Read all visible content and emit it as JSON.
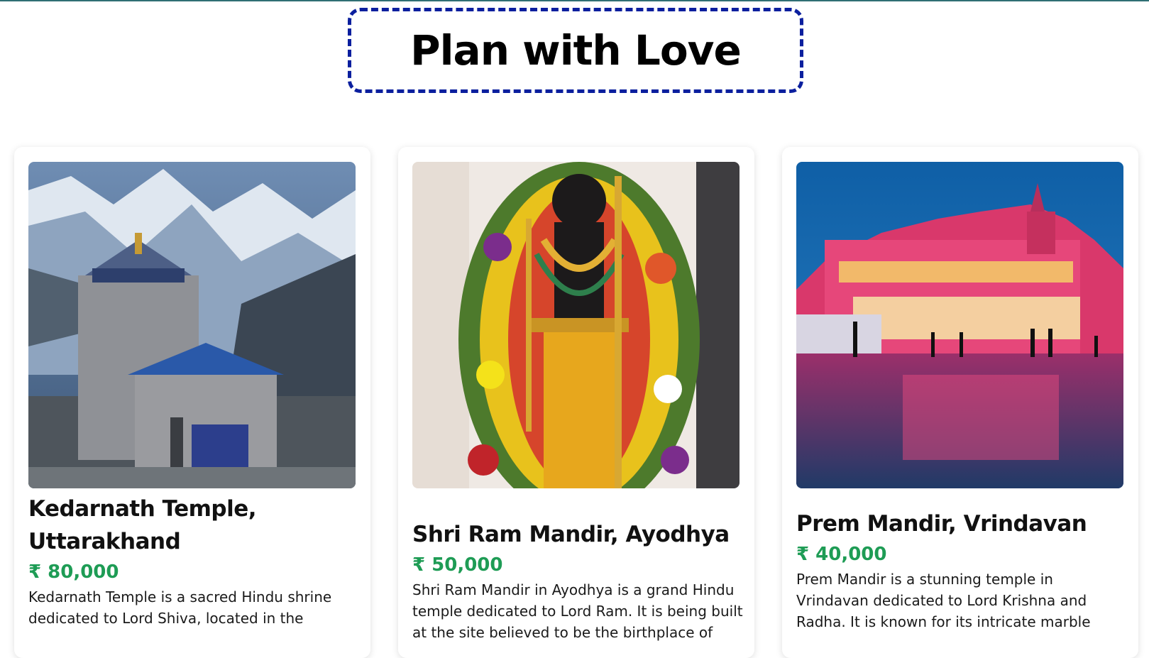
{
  "header": {
    "title": "Plan with Love"
  },
  "cards": [
    {
      "title": "Kedarnath Temple, Uttarakhand",
      "price": "₹ 80,000",
      "description": "Kedarnath Temple is a sacred Hindu shrine dedicated to Lord Shiva, located in the",
      "image": "kedarnath-temple-photo"
    },
    {
      "title": "Shri Ram Mandir, Ayodhya",
      "price": "₹ 50,000",
      "description": "Shri Ram Mandir in Ayodhya is a grand Hindu temple dedicated to Lord Ram. It is being built at the site believed to be the birthplace of",
      "image": "ram-lalla-idol-photo"
    },
    {
      "title": "Prem Mandir, Vrindavan",
      "price": "₹ 40,000",
      "description": "Prem Mandir is a stunning temple in Vrindavan dedicated to Lord Krishna and Radha. It is known for its intricate marble",
      "image": "prem-mandir-night-photo"
    }
  ],
  "colors": {
    "title_border": "#0b1f9e",
    "price": "#1e9c55",
    "top_line": "#2f6f73"
  }
}
